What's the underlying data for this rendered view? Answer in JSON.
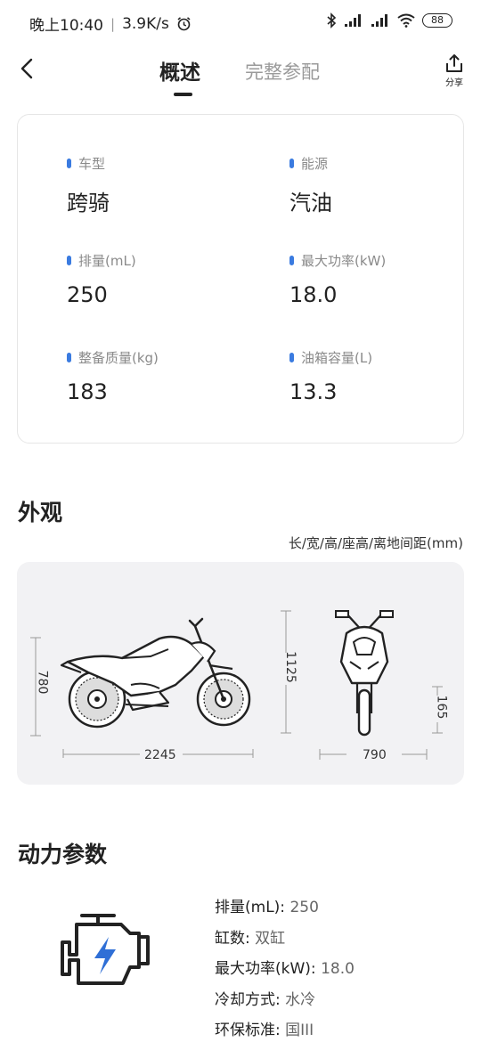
{
  "status_bar": {
    "time": "晚上10:40",
    "speed": "3.9K/s",
    "battery": "88",
    "icons": [
      "alarm-icon",
      "bluetooth-icon",
      "signal-icon",
      "signal-icon",
      "wifi-icon",
      "battery-icon"
    ]
  },
  "nav": {
    "tabs": [
      {
        "label": "概述",
        "active": true
      },
      {
        "label": "完整参配",
        "active": false
      }
    ],
    "share_label": "分享"
  },
  "overview": {
    "specs": [
      {
        "label": "车型",
        "value": "跨骑"
      },
      {
        "label": "能源",
        "value": "汽油"
      },
      {
        "label": "排量(mL)",
        "value": "250"
      },
      {
        "label": "最大功率(kW)",
        "value": "18.0"
      },
      {
        "label": "整备质量(kg)",
        "value": "183"
      },
      {
        "label": "油箱容量(L)",
        "value": "13.3"
      }
    ],
    "accent_color": "#3a7be0"
  },
  "appearance": {
    "title": "外观",
    "caption": "长/宽/高/座高/离地间距(mm)",
    "seat_height": "780",
    "length": "2245",
    "height": "1125",
    "width": "790",
    "ground_clearance": "165"
  },
  "power": {
    "title": "动力参数",
    "rows": [
      {
        "label": "排量(mL):",
        "value": "250"
      },
      {
        "label": "缸数:",
        "value": "双缸"
      },
      {
        "label": "最大功率(kW):",
        "value": "18.0"
      },
      {
        "label": "冷却方式:",
        "value": "水冷"
      },
      {
        "label": "环保标准:",
        "value": "国III"
      }
    ]
  }
}
